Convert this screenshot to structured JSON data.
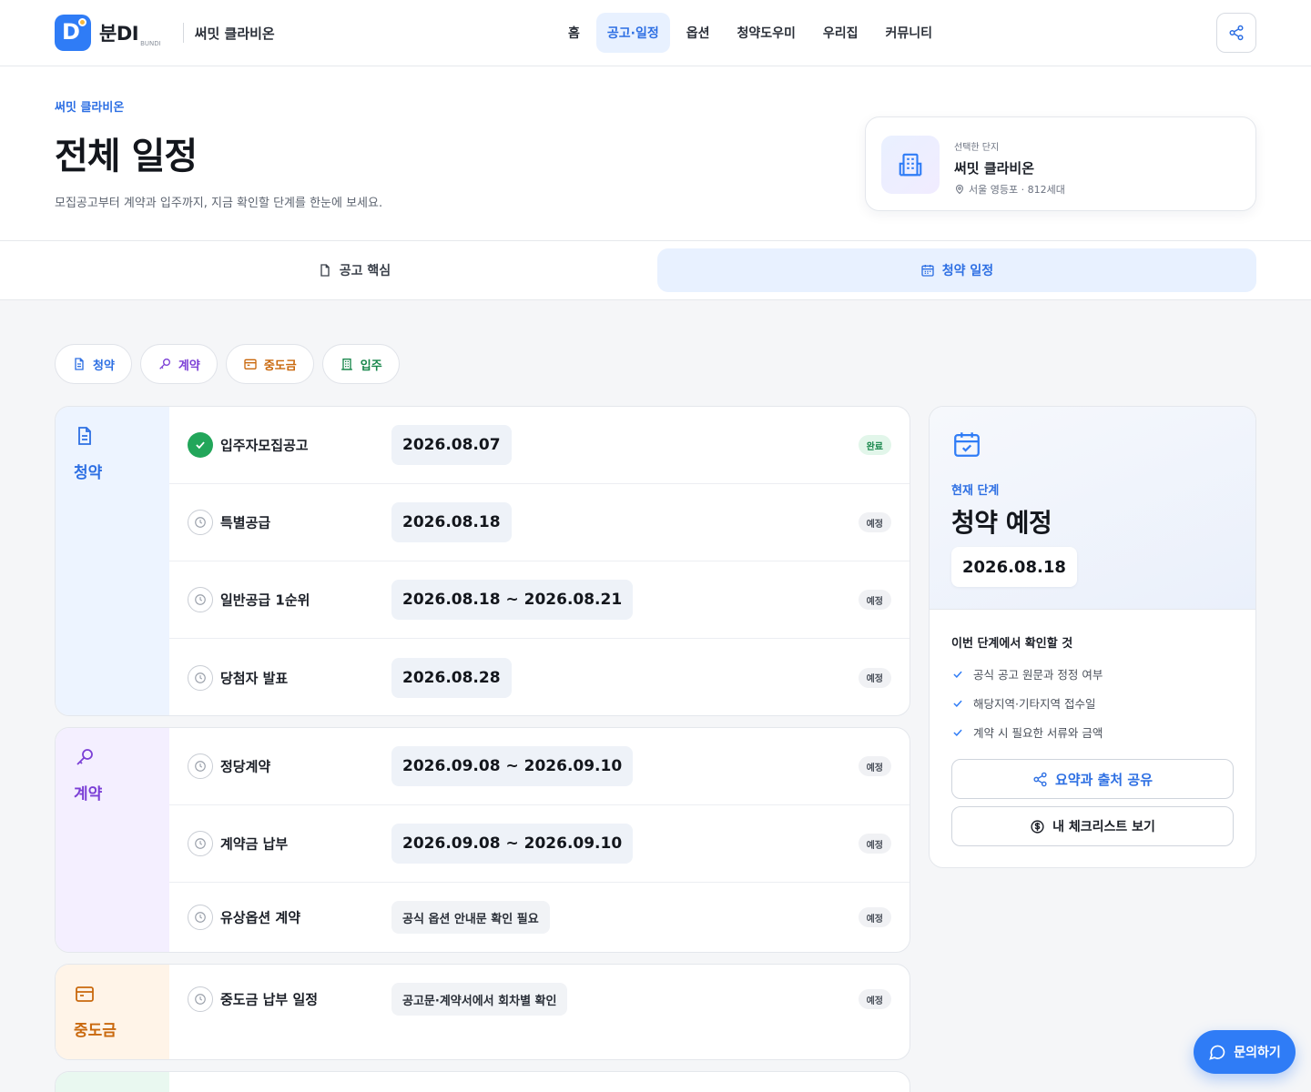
{
  "header": {
    "logo_text": "분DI",
    "logo_sub": "BUNDI",
    "site_name": "써밋 클라비온",
    "nav": [
      "홈",
      "공고·일정",
      "옵션",
      "청약도우미",
      "우리집",
      "커뮤니티"
    ],
    "active_nav": "공고·일정"
  },
  "hero": {
    "eyebrow": "써밋 클라비온",
    "title": "전체 일정",
    "lead": "모집공고부터 계약과 입주까지, 지금 확인할 단계를 한눈에 보세요.",
    "card": {
      "label": "선택한 단지",
      "name": "써밋 클라비온",
      "meta": "서울 영등포 · 812세대"
    }
  },
  "tabs": {
    "t1": "공고 핵심",
    "t2": "청약 일정"
  },
  "chips": {
    "c1": "청약",
    "c2": "계약",
    "c3": "중도금",
    "c4": "입주"
  },
  "groups": {
    "subscription": {
      "label": "청약",
      "rows": [
        {
          "name": "입주자모집공고",
          "date": "2026.08.07",
          "status": "완료"
        },
        {
          "name": "특별공급",
          "date": "2026.08.18",
          "status": "예정"
        },
        {
          "name": "일반공급 1순위",
          "date": "2026.08.18 ~ 2026.08.21",
          "status": "예정"
        },
        {
          "name": "당첨자 발표",
          "date": "2026.08.28",
          "status": "예정"
        }
      ]
    },
    "contract": {
      "label": "계약",
      "rows": [
        {
          "name": "정당계약",
          "date": "2026.09.08 ~ 2026.09.10",
          "status": "예정"
        },
        {
          "name": "계약금 납부",
          "date": "2026.09.08 ~ 2026.09.10",
          "status": "예정"
        },
        {
          "name": "유상옵션 계약",
          "date": "공식 옵션 안내문 확인 필요",
          "status": "예정"
        }
      ]
    },
    "midpay": {
      "label": "중도금",
      "rows": [
        {
          "name": "중도금 납부 일정",
          "date": "공고문·계약서에서 회차별 확인",
          "status": "예정"
        }
      ]
    }
  },
  "panel": {
    "label": "현재 단계",
    "title": "청약 예정",
    "date": "2026.08.18",
    "subhead": "이번 단계에서 확인할 것",
    "checks": [
      "공식 공고 원문과 정정 여부",
      "해당지역·기타지역 접수일",
      "계약 시 필요한 서류와 금액"
    ],
    "btn_share": "요약과 출처 공유",
    "btn_checklist": "내 체크리스트 보기"
  },
  "fab": "문의하기",
  "colors": {
    "accent": "#2f7cf6",
    "subscription_bg": "#edf4ff",
    "contract_bg": "#f4efff",
    "midpay_bg": "#fff4e8",
    "movein_bg": "#e9f8f0"
  }
}
